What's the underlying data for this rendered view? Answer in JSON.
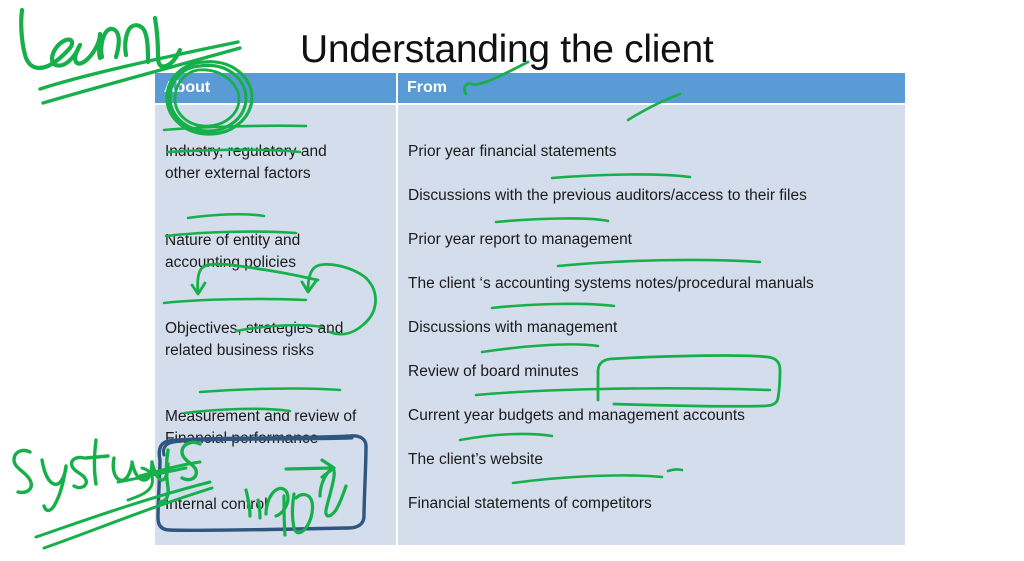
{
  "slide": {
    "title": "Understanding the client",
    "background_color": "#FFFFFF"
  },
  "table": {
    "header_background": "#5B9BD5",
    "header_text_color": "#FFFFFF",
    "body_background": "#D4DDEC",
    "columns": [
      {
        "key": "about",
        "header": "About"
      },
      {
        "key": "from",
        "header": "From"
      }
    ],
    "about_items": [
      "Industry, regulatory and\nother external factors",
      "Nature of entity and\naccounting policies",
      "Objectives, strategies and\nrelated business risks",
      "Measurement and review of\nFinancial performance",
      "Internal control"
    ],
    "from_items": [
      "Prior year financial statements",
      "Discussions with the previous auditors/access to their files",
      "Prior year report to management",
      "The client ‘s accounting systems notes/procedural manuals",
      "Discussions with management",
      "Review of board minutes",
      "Current year budgets and management accounts",
      "The client’s  website",
      "Financial statements of competitors"
    ]
  },
  "annotations": {
    "ink_green_color": "#16B04A",
    "ink_navy_color": "#2E567F",
    "handwritten": [
      {
        "name": "learn-note",
        "text": "Learn"
      },
      {
        "name": "systems-note",
        "text": "Systems"
      },
      {
        "name": "indepth-note",
        "text": "Indepth"
      }
    ],
    "marks": [
      "circle-around-About-header",
      "double-strike-through-under-Learn",
      "underline-Industry-regulatory-and",
      "underline-other-external-factors",
      "underline-Nature-of-entity-and",
      "underline-accounting-policies",
      "underline-Objectives-strategies-and",
      "underline-related-business-risks",
      "bracket-around-objectives-row",
      "underline-Measurement-and-review-of",
      "underline-Financial-performance",
      "navy-box-around-Internal-control",
      "arrow-from-Internal-control",
      "tick-next-to-From-header",
      "stroke-after-Prior-year-financial-statements",
      "underline-previous-auditors",
      "underline-report-to-management",
      "underline-accounting-systems-notes",
      "underline-Discussions-with-management",
      "underline-Review-of-board-minutes",
      "box-around-management-accounts",
      "underline-Current-year-budgets",
      "underline-The-clients-website",
      "underline-Financial-statements-of-competitors",
      "arrow-from-Systems-to-Internal-control"
    ]
  }
}
